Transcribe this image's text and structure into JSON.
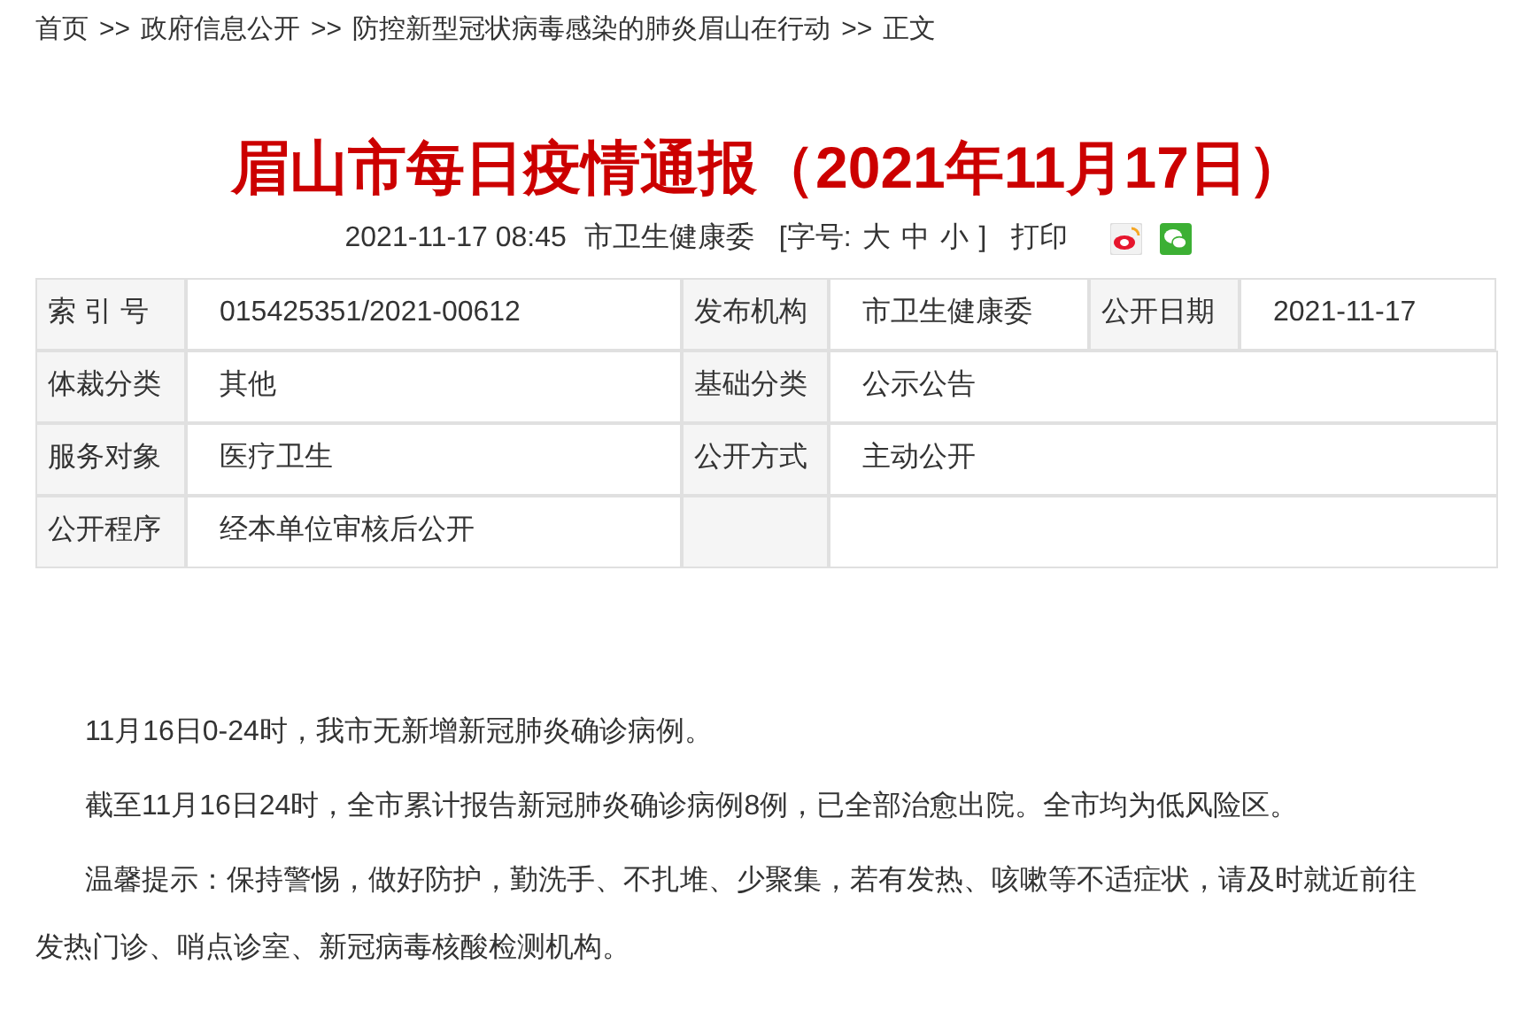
{
  "breadcrumb": {
    "items": [
      "首页",
      "政府信息公开",
      "防控新型冠状病毒感染的肺炎眉山在行动",
      "正文"
    ],
    "separator": ">>"
  },
  "title": "眉山市每日疫情通报（2021年11月17日）",
  "meta": {
    "datetime": "2021-11-17 08:45",
    "source": "市卫生健康委",
    "font_size_open": "[字号:",
    "sizes": [
      "大",
      "中",
      "小"
    ],
    "font_size_close": "]",
    "print": "打印"
  },
  "table": {
    "rows": [
      [
        {
          "kind": "label",
          "text": "索 引 号"
        },
        {
          "kind": "value",
          "text": "015425351/2021-00612"
        },
        {
          "kind": "label",
          "text": "发布机构"
        },
        {
          "kind": "value",
          "text": "市卫生健康委"
        },
        {
          "kind": "label",
          "text": "公开日期"
        },
        {
          "kind": "value",
          "text": "2021-11-17"
        }
      ],
      [
        {
          "kind": "label",
          "text": "体裁分类"
        },
        {
          "kind": "value",
          "text": "其他"
        },
        {
          "kind": "label",
          "text": "基础分类"
        },
        {
          "kind": "wide",
          "text": "公示公告"
        }
      ],
      [
        {
          "kind": "label",
          "text": "服务对象"
        },
        {
          "kind": "value",
          "text": "医疗卫生"
        },
        {
          "kind": "label",
          "text": "公开方式"
        },
        {
          "kind": "wide",
          "text": "主动公开"
        }
      ],
      [
        {
          "kind": "label",
          "text": "公开程序"
        },
        {
          "kind": "value",
          "text": "经本单位审核后公开"
        },
        {
          "kind": "empty_label"
        },
        {
          "kind": "empty_wide"
        }
      ]
    ]
  },
  "paragraphs": [
    "11月16日0-24时，我市无新增新冠肺炎确诊病例。",
    "截至11月16日24时，全市累计报告新冠肺炎确诊病例8例，已全部治愈出院。全市均为低风险区。",
    "温馨提示：保持警惕，做好防护，勤洗手、不扎堆、少聚集，若有发热、咳嗽等不适症状，请及时就近前往发热门诊、哨点诊室、新冠病毒核酸检测机构。"
  ]
}
